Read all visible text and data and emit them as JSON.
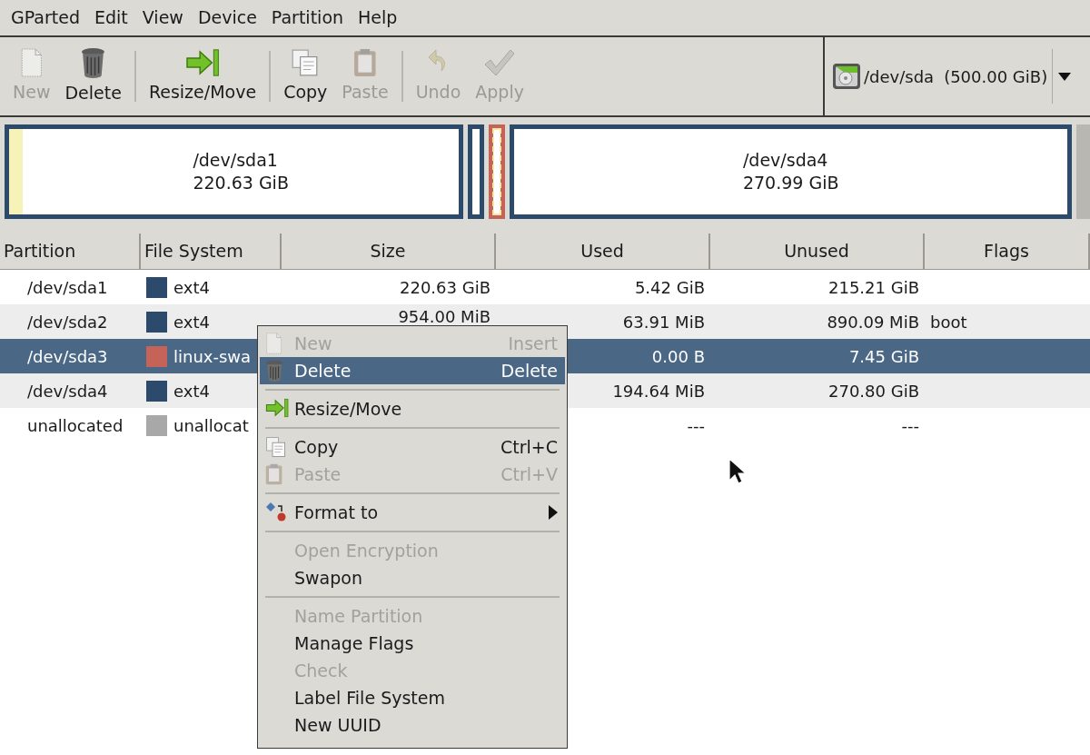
{
  "menubar": [
    "GParted",
    "Edit",
    "View",
    "Device",
    "Partition",
    "Help"
  ],
  "toolbar": [
    {
      "kind": "button",
      "label": "New",
      "disabled": true
    },
    {
      "kind": "button",
      "label": "Delete",
      "disabled": false
    },
    {
      "kind": "separator"
    },
    {
      "kind": "button",
      "label": "Resize/Move",
      "disabled": false
    },
    {
      "kind": "separator"
    },
    {
      "kind": "button",
      "label": "Copy",
      "disabled": false
    },
    {
      "kind": "button",
      "label": "Paste",
      "disabled": true
    },
    {
      "kind": "separator"
    },
    {
      "kind": "button",
      "label": "Undo",
      "disabled": true
    },
    {
      "kind": "button",
      "label": "Apply",
      "disabled": true
    }
  ],
  "device_selector": {
    "device": "/dev/sda",
    "size": "(500.00 GiB)"
  },
  "disk_map": [
    {
      "kind": "labeled",
      "name": "/dev/sda1",
      "size": "220.63 GiB",
      "color": "#2c4a6b",
      "level": 0.03,
      "selected": false
    },
    {
      "kind": "sliver",
      "color": "#2c4a6b",
      "selected": false
    },
    {
      "kind": "sliver",
      "color": "#c66358",
      "selected": true
    },
    {
      "kind": "labeled",
      "name": "/dev/sda4",
      "size": "270.99 GiB",
      "color": "#2c4a6b",
      "level": 0,
      "selected": false
    }
  ],
  "table": {
    "columns": [
      "Partition",
      "File System",
      "Size",
      "Used",
      "Unused",
      "Flags"
    ],
    "rows": [
      {
        "partition": "/dev/sda1",
        "file_system": "ext4",
        "color": "#2c4a6b",
        "size": "220.63 GiB",
        "used": "5.42 GiB",
        "unused": "215.21 GiB",
        "flags": "",
        "selected": false
      },
      {
        "partition": "/dev/sda2",
        "file_system": "ext4",
        "color": "#2c4a6b",
        "size": "954.00 MiB",
        "used": "63.91 MiB",
        "unused": "890.09 MiB",
        "flags": "boot",
        "selected": false
      },
      {
        "partition": "/dev/sda3",
        "file_system": "linux-swa",
        "color": "#c66358",
        "size": "",
        "used": "0.00 B",
        "unused": "7.45 GiB",
        "flags": "",
        "selected": true
      },
      {
        "partition": "/dev/sda4",
        "file_system": "ext4",
        "color": "#2c4a6b",
        "size": "",
        "used": "194.64 MiB",
        "unused": "270.80 GiB",
        "flags": "",
        "selected": false
      },
      {
        "partition": "unallocated",
        "file_system": "unallocat",
        "color": "#a8a8a8",
        "size": "",
        "used": "---",
        "unused": "---",
        "flags": "",
        "selected": false
      }
    ]
  },
  "context_menu": [
    {
      "kind": "item",
      "label": "New",
      "shortcut": "Insert",
      "disabled": true,
      "selected": false
    },
    {
      "kind": "item",
      "label": "Delete",
      "shortcut": "Delete",
      "disabled": false,
      "selected": true
    },
    {
      "kind": "separator"
    },
    {
      "kind": "item",
      "label": "Resize/Move",
      "disabled": false,
      "selected": false
    },
    {
      "kind": "separator"
    },
    {
      "kind": "item",
      "label": "Copy",
      "shortcut": "Ctrl+C",
      "disabled": false,
      "selected": false
    },
    {
      "kind": "item",
      "label": "Paste",
      "shortcut": "Ctrl+V",
      "disabled": true,
      "selected": false
    },
    {
      "kind": "separator"
    },
    {
      "kind": "submenu",
      "label": "Format to",
      "disabled": false,
      "selected": false
    },
    {
      "kind": "separator"
    },
    {
      "kind": "item",
      "label": "Open Encryption",
      "disabled": true,
      "selected": false
    },
    {
      "kind": "item",
      "label": "Swapon",
      "disabled": false,
      "selected": false
    },
    {
      "kind": "separator"
    },
    {
      "kind": "item",
      "label": "Name Partition",
      "disabled": true,
      "selected": false
    },
    {
      "kind": "item",
      "label": "Manage Flags",
      "disabled": false,
      "selected": false
    },
    {
      "kind": "item",
      "label": "Check",
      "disabled": true,
      "selected": false
    },
    {
      "kind": "item",
      "label": "Label File System",
      "disabled": false,
      "selected": false
    },
    {
      "kind": "item",
      "label": "New UUID",
      "disabled": false,
      "selected": false
    }
  ]
}
